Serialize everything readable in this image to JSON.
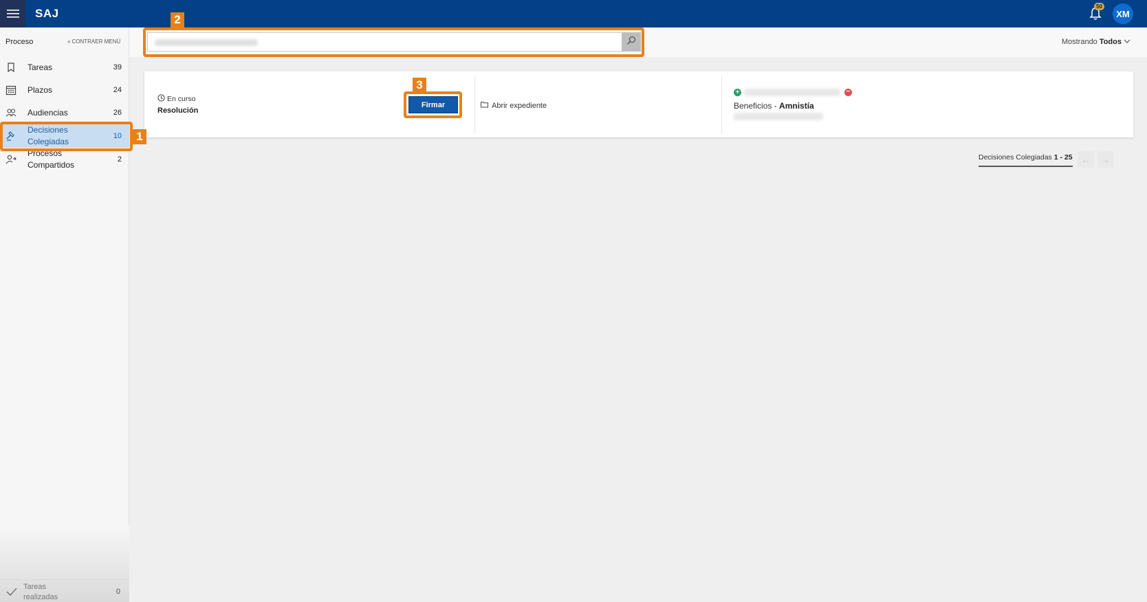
{
  "app": {
    "title": "SAJ",
    "notifications": "50",
    "user_initials": "XM"
  },
  "sidebar": {
    "header": "Proceso",
    "collapse_label": "CONTRAER MENÚ",
    "items": [
      {
        "label": "Tareas",
        "count": "39",
        "icon": "bookmark-icon"
      },
      {
        "label": "Plazos",
        "count": "24",
        "icon": "calendar-icon"
      },
      {
        "label": "Audiencias",
        "count": "26",
        "icon": "people-icon"
      },
      {
        "label": "Decisiones Colegiadas",
        "count": "10",
        "icon": "gavel-icon",
        "active": true
      },
      {
        "label": "Procesos Compartidos",
        "count": "2",
        "icon": "user-share-icon"
      }
    ],
    "footer": {
      "label": "Tareas realizadas",
      "count": "0",
      "icon": "check-icon"
    }
  },
  "filter": {
    "search_value": "",
    "showing_prefix": "Mostrando",
    "showing_value": "Todos"
  },
  "card": {
    "status": "En curso",
    "type": "Resolución",
    "sign_button": "Firmar",
    "open_link": "Abrir expediente",
    "benefit_prefix": "Beneficios - ",
    "benefit_value": "Amnistía"
  },
  "pager": {
    "label": "Decisiones Colegiadas ",
    "range": "1 - 25"
  },
  "callouts": {
    "step1": "1",
    "step2": "2",
    "step3": "3"
  },
  "colors": {
    "header": "#034088",
    "accent": "#e7811b",
    "primary_button": "#1259a8",
    "active_item": "#c9ddf2"
  }
}
